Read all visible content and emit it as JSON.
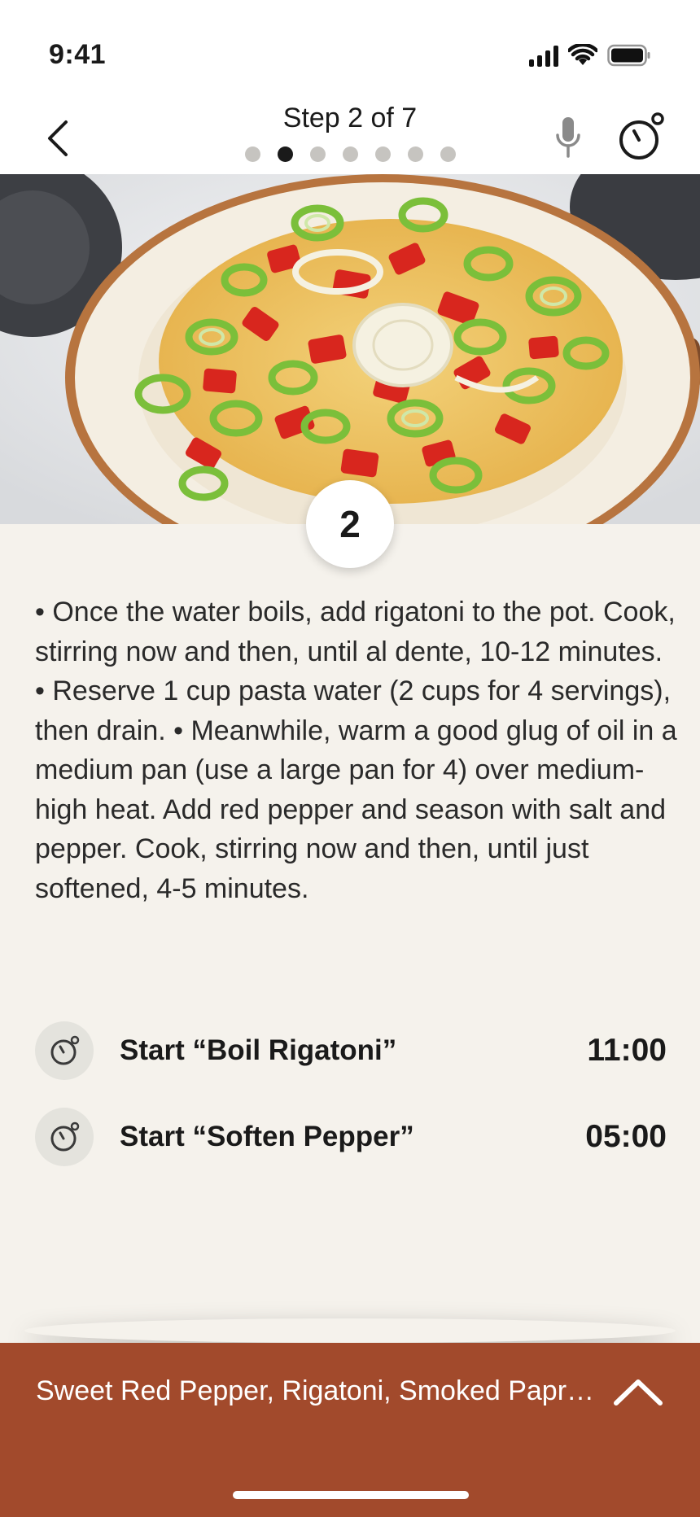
{
  "status_bar": {
    "time": "9:41"
  },
  "nav": {
    "step_title": "Step 2 of 7",
    "total_steps": 7,
    "current_step_index": 1
  },
  "step": {
    "number": "2",
    "instructions": "• Once the water boils, add rigatoni to the pot. Cook, stirring now and then, until al dente, 10-12 minutes. • Reserve 1 cup pasta water (2 cups for 4 servings), then drain. • Meanwhile, warm a good glug of oil in a medium pan (use a large pan for 4) over medium-high heat. Add red pepper and season with salt and pepper. Cook, stirring now and then, until just softened, 4-5 minutes."
  },
  "timers": [
    {
      "label": "Start “Boil Rigatoni”",
      "value": "11:00"
    },
    {
      "label": "Start “Soften Pepper”",
      "value": "05:00"
    }
  ],
  "ingredients_sheet": {
    "summary": "Sweet Red Pepper, Rigatoni, Smoked Paprika, Garlic"
  },
  "icons": {
    "back": "chevron-left-icon",
    "mic": "microphone-icon",
    "timer": "stopwatch-icon",
    "expand": "chevron-up-icon"
  },
  "colors": {
    "accent": "#a24a2c",
    "content_bg": "#f5f2ec",
    "dot_inactive": "#c6c4c0",
    "dot_active": "#1a1a1a"
  }
}
